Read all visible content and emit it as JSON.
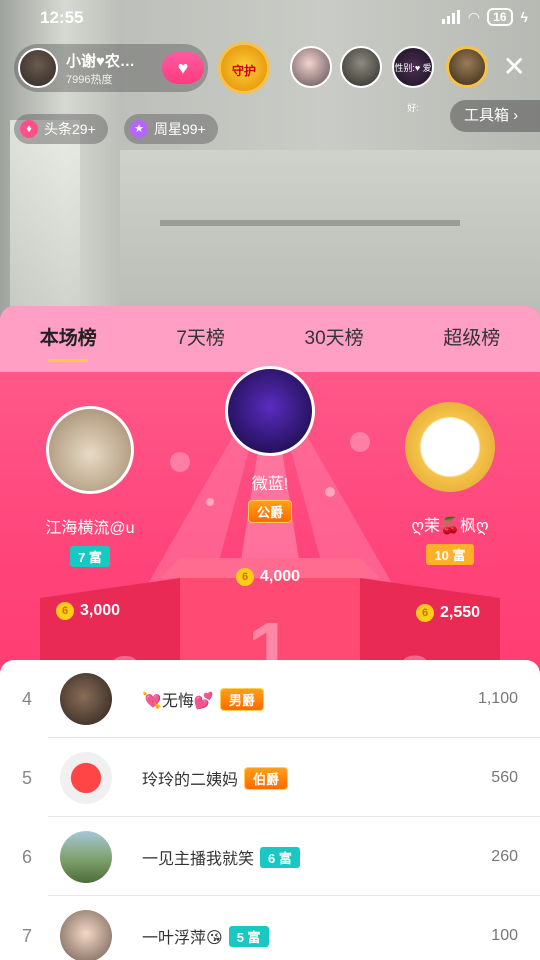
{
  "status_bar": {
    "time": "12:55",
    "battery": "16"
  },
  "host": {
    "name": "小谢♥农…",
    "heat": "7996热度"
  },
  "guard_label": "守护",
  "viewer_v3_text": "性别:♥ 爱好:",
  "toolbox_label": "工具箱 ›",
  "pills": [
    {
      "label": "头条29+"
    },
    {
      "label": "周星99+"
    }
  ],
  "tabs": [
    {
      "label": "本场榜",
      "active": true
    },
    {
      "label": "7天榜"
    },
    {
      "label": "30天榜"
    },
    {
      "label": "超级榜"
    }
  ],
  "podium": {
    "first": {
      "name": "微蓝!",
      "noble": "公爵",
      "coins": "4,000",
      "rank": "1"
    },
    "second": {
      "name": "江海横流@u",
      "rich": "7 富",
      "coins": "3,000",
      "rank": "2"
    },
    "third": {
      "name": "ღ茉🍒枫ღ",
      "rich": "10 富",
      "coins": "2,550",
      "rank": "3"
    }
  },
  "list": [
    {
      "rank": "4",
      "name": "💘无悔💕",
      "badge": "男爵",
      "badge_type": "noble",
      "score": "1,100"
    },
    {
      "rank": "5",
      "name": "玲玲的二姨妈",
      "badge": "伯爵",
      "badge_type": "noble",
      "score": "560"
    },
    {
      "rank": "6",
      "name": "一见主播我就笑",
      "badge": "6 富",
      "badge_type": "rich",
      "score": "260"
    },
    {
      "rank": "7",
      "name": "一叶浮萍😘",
      "badge": "5 富",
      "badge_type": "rich",
      "score": "100"
    }
  ],
  "colors": {
    "panel_top": "#ff5f8e",
    "panel_bottom": "#ff2f64",
    "tabs_bg": "#ff9fc4",
    "rich_badge": "#19c8c2",
    "coin": "#ffcc1a"
  }
}
